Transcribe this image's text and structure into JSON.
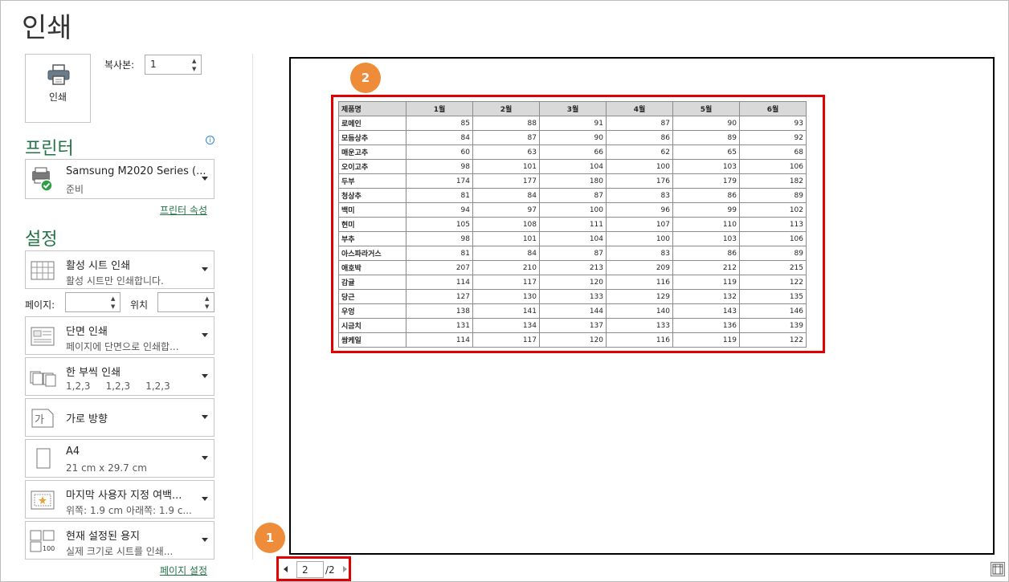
{
  "title": "인쇄",
  "print_button": {
    "label": "인쇄",
    "icon": "printer-icon"
  },
  "copies": {
    "label": "복사본:",
    "value": "1"
  },
  "printer": {
    "heading": "프린터",
    "name": "Samsung M2020 Series (...",
    "status": "준비",
    "properties_link": "프린터 속성"
  },
  "settings": {
    "heading": "설정",
    "pages_label": "페이지:",
    "to_label": "위치",
    "items": [
      {
        "line1": "활성 시트 인쇄",
        "line2": "활성 시트만 인쇄합니다.",
        "icon": "sheet-grid-icon"
      },
      {
        "line1": "단면 인쇄",
        "line2": "페이지에 단면으로 인쇄합...",
        "icon": "one-sided-icon"
      },
      {
        "line1": "한 부씩 인쇄",
        "line2": "1,2,3     1,2,3     1,2,3",
        "icon": "collated-icon"
      },
      {
        "line1": "가로 방향",
        "line2": "",
        "icon": "landscape-icon"
      },
      {
        "line1": "A4",
        "line2": "21 cm x 29.7 cm",
        "icon": "paper-size-icon"
      },
      {
        "line1": "마지막 사용자 지정 여백...",
        "line2": "위쪽: 1.9 cm 아래쪽: 1.9 c...",
        "icon": "margins-icon"
      },
      {
        "line1": "현재 설정된 용지",
        "line2": "실제 크기로 시트를 인쇄...",
        "icon": "scaling-icon"
      }
    ],
    "page_setup_link": "페이지 설정"
  },
  "annotations": {
    "badge1": "1",
    "badge2": "2"
  },
  "page_nav": {
    "current": "2",
    "total": "/2"
  },
  "sheet": {
    "headers": [
      "제품명",
      "1월",
      "2월",
      "3월",
      "4월",
      "5월",
      "6월"
    ],
    "rows": [
      [
        "로메인",
        "85",
        "88",
        "91",
        "87",
        "90",
        "93"
      ],
      [
        "모듬상추",
        "84",
        "87",
        "90",
        "86",
        "89",
        "92"
      ],
      [
        "매운고추",
        "60",
        "63",
        "66",
        "62",
        "65",
        "68"
      ],
      [
        "오이고추",
        "98",
        "101",
        "104",
        "100",
        "103",
        "106"
      ],
      [
        "두부",
        "174",
        "177",
        "180",
        "176",
        "179",
        "182"
      ],
      [
        "청상추",
        "81",
        "84",
        "87",
        "83",
        "86",
        "89"
      ],
      [
        "백미",
        "94",
        "97",
        "100",
        "96",
        "99",
        "102"
      ],
      [
        "현미",
        "105",
        "108",
        "111",
        "107",
        "110",
        "113"
      ],
      [
        "부추",
        "98",
        "101",
        "104",
        "100",
        "103",
        "106"
      ],
      [
        "아스파라거스",
        "81",
        "84",
        "87",
        "83",
        "86",
        "89"
      ],
      [
        "애호박",
        "207",
        "210",
        "213",
        "209",
        "212",
        "215"
      ],
      [
        "감귤",
        "114",
        "117",
        "120",
        "116",
        "119",
        "122"
      ],
      [
        "당근",
        "127",
        "130",
        "133",
        "129",
        "132",
        "135"
      ],
      [
        "우엉",
        "138",
        "141",
        "144",
        "140",
        "143",
        "146"
      ],
      [
        "시금치",
        "131",
        "134",
        "137",
        "133",
        "136",
        "139"
      ],
      [
        "쌈케일",
        "114",
        "117",
        "120",
        "116",
        "119",
        "122"
      ]
    ]
  },
  "colors": {
    "accent": "#217346",
    "highlight": "#e00000",
    "badge": "#ee8c3a"
  }
}
